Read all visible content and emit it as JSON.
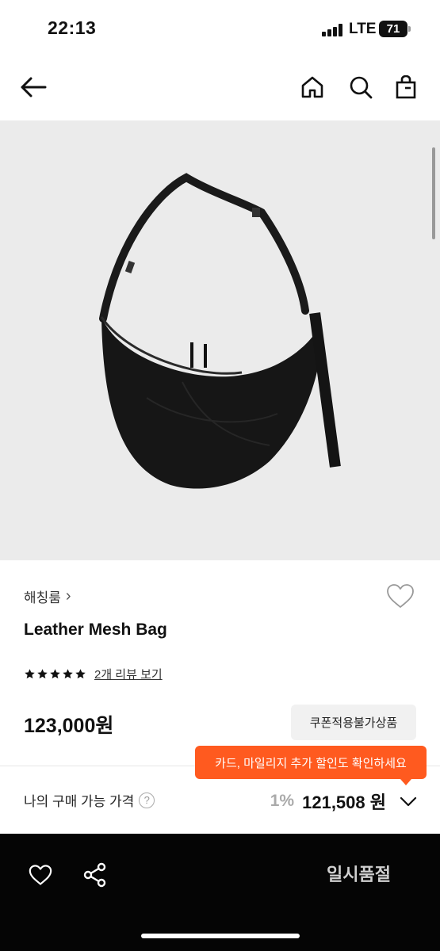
{
  "status_bar": {
    "time": "22:13",
    "network": "LTE",
    "battery": "71"
  },
  "nav": {
    "icons": [
      "back-arrow-icon",
      "home-icon",
      "search-icon",
      "shopping-bag-icon"
    ]
  },
  "product": {
    "brand": "해칭룸",
    "brand_chevron": "›",
    "name": "Leather Mesh Bag",
    "rating_stars": 5,
    "review_link": "2개 리뷰 보기",
    "price": "123,000원",
    "coupon_badge": "쿠폰적용불가상품"
  },
  "promo_tooltip": "카드, 마일리지 추가 할인도 확인하세요",
  "my_price": {
    "label": "나의 구매 가능 가격",
    "help": "?",
    "discount": "1%",
    "price": "121,508 원"
  },
  "bottom_bar": {
    "status_label": "일시품절"
  },
  "colors": {
    "accent": "#ff5a1f",
    "bottom_bar": "#050505",
    "hero_bg": "#ebebeb"
  }
}
